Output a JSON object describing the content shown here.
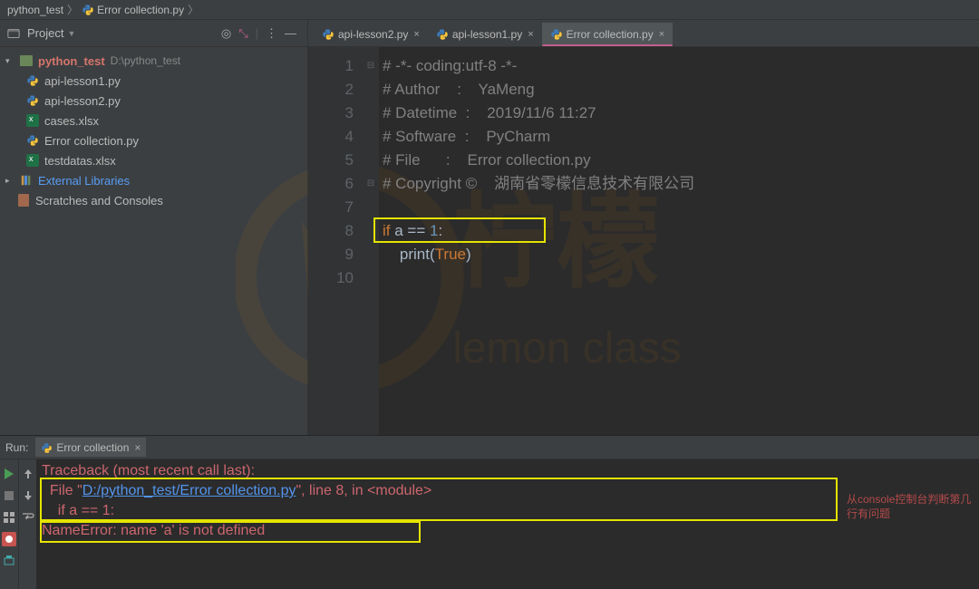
{
  "breadcrumb": {
    "proj": "python_test",
    "file": "Error collection.py"
  },
  "sidebar": {
    "selector": "Project",
    "project": {
      "name": "python_test",
      "path": "D:\\python_test"
    },
    "files": [
      "api-lesson1.py",
      "api-lesson2.py",
      "cases.xlsx",
      "Error collection.py",
      "testdatas.xlsx"
    ],
    "external": "External Libraries",
    "scratches": "Scratches and Consoles"
  },
  "tabs": [
    {
      "label": "api-lesson2.py"
    },
    {
      "label": "api-lesson1.py"
    },
    {
      "label": "Error collection.py",
      "active": true
    }
  ],
  "code": {
    "lines": [
      "# -*- coding:utf-8 -*-",
      "# Author    :    YaMeng",
      "# Datetime  :    2019/11/6 11:27",
      "# Software  :    PyCharm",
      "# File      :    Error collection.py",
      "# Copyright ©    湖南省零檬信息技术有限公司",
      "",
      "if a == 1:",
      "    print(True)",
      ""
    ],
    "nums": [
      "1",
      "2",
      "3",
      "4",
      "5",
      "6",
      "7",
      "8",
      "9",
      "10"
    ]
  },
  "run": {
    "label": "Run:",
    "tab": "Error collection",
    "lines": {
      "trace": "Traceback (most recent call last):",
      "filepre": "  File \"",
      "filelink": "D:/python_test/Error collection.py",
      "filepost": "\", line 8, in <module>",
      "ifline": "    if a == 1:",
      "err": "NameError: name 'a' is not defined"
    },
    "note": "从console控制台判断第几行有问题"
  }
}
